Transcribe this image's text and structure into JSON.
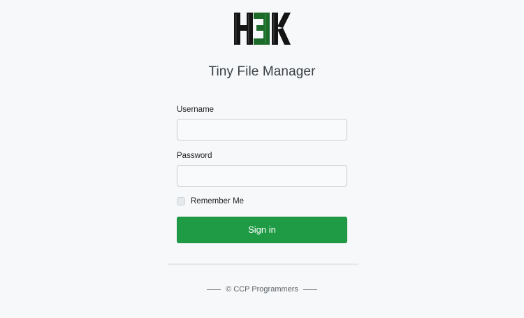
{
  "logo": {
    "text": "H3K",
    "colors": {
      "black": "#141414",
      "green": "#1d6b2a"
    }
  },
  "app_title": "Tiny File Manager",
  "form": {
    "username_label": "Username",
    "username_value": "",
    "password_label": "Password",
    "password_value": "",
    "remember_label": "Remember Me",
    "remember_checked": false,
    "signin_label": "Sign in"
  },
  "footer": {
    "text": "© CCP Programmers"
  },
  "colors": {
    "background": "#f6f8f9",
    "button": "#1f9b45",
    "title": "#3a3f44"
  }
}
